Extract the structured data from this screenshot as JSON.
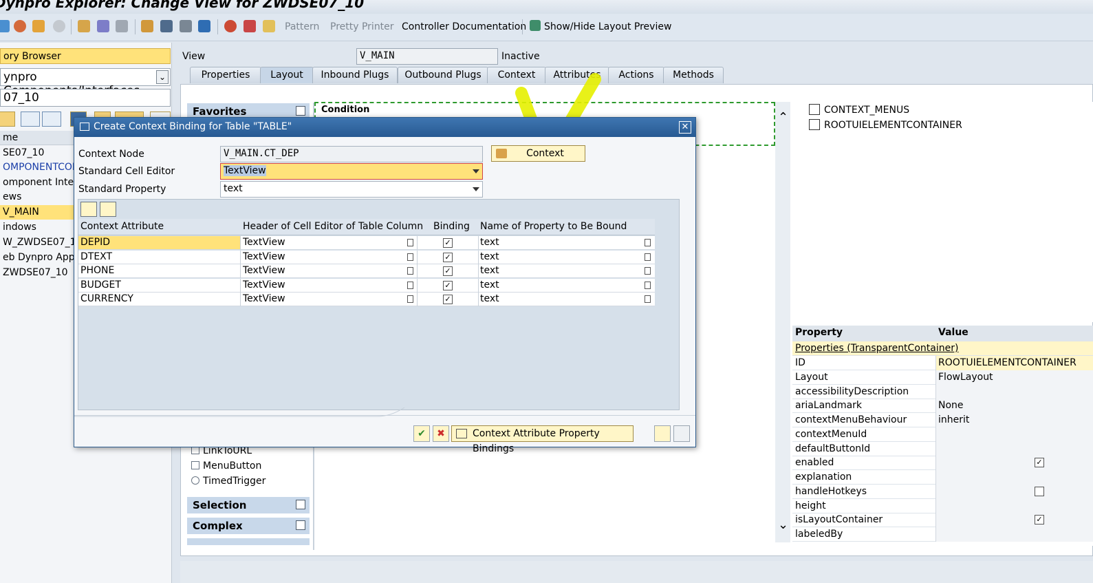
{
  "window": {
    "title": "Dynpro Explorer: Change View for ZWDSE07_10"
  },
  "toolbar": {
    "pattern": "Pattern",
    "pretty_printer": "Pretty Printer",
    "controller_doc": "Controller Documentation",
    "layout_preview": "Show/Hide Layout Preview"
  },
  "left": {
    "browser": "ory Browser",
    "object_type": "ynpro Components/Interfaces",
    "object_name": "07_10",
    "tree_header": "me",
    "tree": [
      "SE07_10",
      "OMPONENTCONT",
      "omponent Interfa",
      "ews",
      "V_MAIN",
      "indows",
      "W_ZWDSE07_10",
      "eb Dynpro Applic",
      "ZWDSE07_10"
    ]
  },
  "view": {
    "label": "View",
    "name": "V_MAIN",
    "status": "Inactive"
  },
  "tabs": [
    "Properties",
    "Layout",
    "Inbound Plugs",
    "Outbound Plugs",
    "Context",
    "Attributes",
    "Actions",
    "Methods"
  ],
  "palette": {
    "favorites": "Favorites",
    "items": [
      "LinkToURL",
      "MenuButton",
      "TimedTrigger"
    ],
    "selection": "Selection",
    "complex": "Complex"
  },
  "canvas": {
    "condition": "Condition"
  },
  "ui_tree": [
    "CONTEXT_MENUS",
    "ROOTUIELEMENTCONTAINER"
  ],
  "properties": {
    "col_property": "Property",
    "col_value": "Value",
    "group": "Properties (TransparentContainer)",
    "rows": [
      {
        "name": "ID",
        "value": "ROOTUIELEMENTCONTAINER"
      },
      {
        "name": "Layout",
        "value": "FlowLayout"
      },
      {
        "name": "accessibilityDescription",
        "value": ""
      },
      {
        "name": "ariaLandmark",
        "value": "None"
      },
      {
        "name": "contextMenuBehaviour",
        "value": "inherit"
      },
      {
        "name": "contextMenuId",
        "value": ""
      },
      {
        "name": "defaultButtonId",
        "value": ""
      },
      {
        "name": "enabled",
        "value": "",
        "checked": true
      },
      {
        "name": "explanation",
        "value": ""
      },
      {
        "name": "handleHotkeys",
        "value": "",
        "checked": false
      },
      {
        "name": "height",
        "value": ""
      },
      {
        "name": "isLayoutContainer",
        "value": "",
        "checked": true
      },
      {
        "name": "labeledBy",
        "value": ""
      }
    ]
  },
  "dialog": {
    "title": "Create Context Binding for Table \"TABLE\"",
    "context_node_label": "Context Node",
    "context_node_value": "V_MAIN.CT_DEP",
    "cell_editor_label": "Standard Cell Editor",
    "cell_editor_value": "TextView",
    "property_label": "Standard Property",
    "property_value": "text",
    "context_button": "Context",
    "grid_headers": [
      "Context Attribute",
      "Header of Cell Editor of Table Column",
      "Binding",
      "Name of Property to Be Bound"
    ],
    "rows": [
      {
        "attr": "DEPID",
        "editor": "TextView",
        "binding": true,
        "prop": "text"
      },
      {
        "attr": "DTEXT",
        "editor": "TextView",
        "binding": true,
        "prop": "text"
      },
      {
        "attr": "PHONE",
        "editor": "TextView",
        "binding": true,
        "prop": "text"
      },
      {
        "attr": "BUDGET",
        "editor": "TextView",
        "binding": true,
        "prop": "text"
      },
      {
        "attr": "CURRENCY",
        "editor": "TextView",
        "binding": true,
        "prop": "text"
      }
    ],
    "bindings_button": "Context Attribute Property Bindings"
  },
  "colors": {
    "highlight": "#ffe27a",
    "annotation": "#e6f000",
    "dialog_title": "#275a92"
  }
}
